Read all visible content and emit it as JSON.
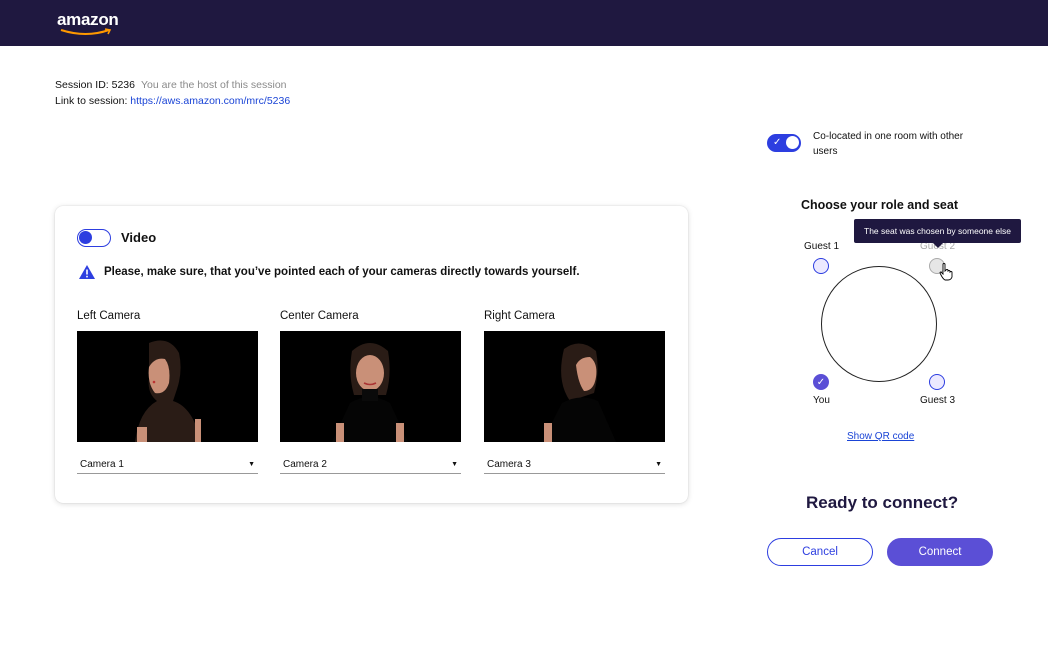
{
  "header": {
    "logo_text": "amazon"
  },
  "session": {
    "id_label": "Session ID: 5236",
    "host_note": "You are the host of this session",
    "link_label": "Link to session:",
    "link_url": "https://aws.amazon.com/mrc/5236"
  },
  "video": {
    "title": "Video",
    "warning": "Please, make sure, that you’ve pointed each of your cameras directly towards yourself.",
    "cameras": [
      {
        "label": "Left Camera",
        "selected": "Camera 1"
      },
      {
        "label": "Center Camera",
        "selected": "Camera 2"
      },
      {
        "label": "Right Camera",
        "selected": "Camera 3"
      }
    ]
  },
  "colocated": {
    "label": "Co-located in one room with other users"
  },
  "role": {
    "title": "Choose your role and seat",
    "seats": {
      "guest1": "Guest 1",
      "guest2": "Guest 2",
      "you": "You",
      "guest3": "Guest 3"
    },
    "tooltip": "The seat was chosen by someone else"
  },
  "qr_link": "Show QR code",
  "ready_title": "Ready to connect?",
  "buttons": {
    "cancel": "Cancel",
    "connect": "Connect"
  },
  "colors": {
    "header_bg": "#1f1840",
    "accent": "#2d3ee0",
    "connect": "#5b4fd6"
  }
}
